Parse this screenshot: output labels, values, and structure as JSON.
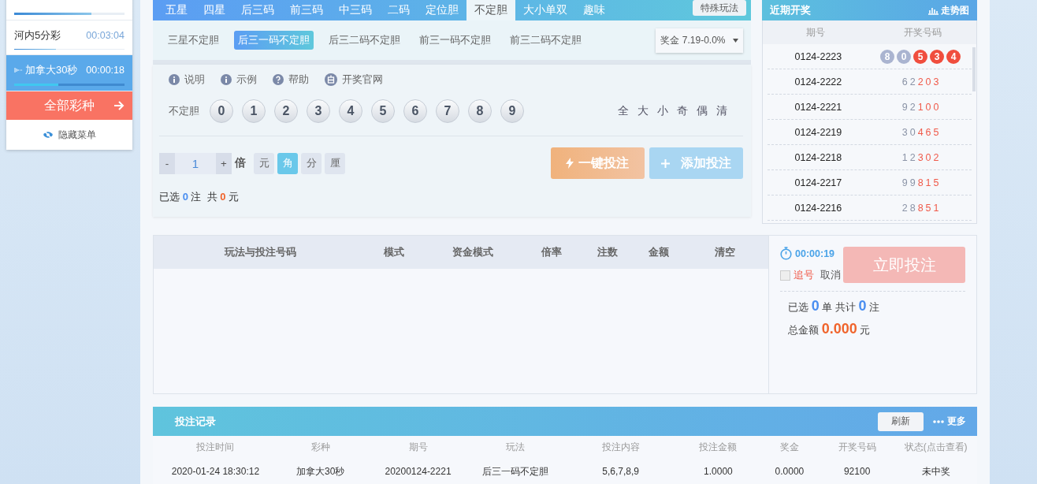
{
  "lotteries": [
    {
      "level": 0.7,
      "selected": false
    },
    {
      "name": "河内5分彩",
      "time": "00:03:04",
      "level": 0.38,
      "selected": false
    },
    {
      "name": "加拿大30秒",
      "time": "00:00:18",
      "level": 0.4,
      "selected": true
    }
  ],
  "all_button": "全部彩种",
  "hide_menu": "隐藏菜单",
  "tabs": [
    {
      "label": "五星",
      "selected": false
    },
    {
      "label": "四星",
      "selected": false
    },
    {
      "label": "后三码",
      "selected": false
    },
    {
      "label": "前三码",
      "selected": false
    },
    {
      "label": "中三码",
      "selected": false
    },
    {
      "label": "二码",
      "selected": false
    },
    {
      "label": "定位胆",
      "selected": false
    },
    {
      "label": "不定胆",
      "selected": true
    },
    {
      "label": "大小单双",
      "selected": false
    },
    {
      "label": "趣味",
      "selected": false
    }
  ],
  "special_button": "特殊玩法",
  "subtabs": [
    {
      "label": "三星不定胆",
      "selected": false
    },
    {
      "label": "后三一码不定胆",
      "selected": true
    },
    {
      "label": "后三二码不定胆",
      "selected": false
    },
    {
      "label": "前三一码不定胆",
      "selected": false
    },
    {
      "label": "前三二码不定胆",
      "selected": false
    }
  ],
  "prize_select": "奖金 7.19-0.0%",
  "info_links": [
    {
      "kind": "info",
      "label": "说明"
    },
    {
      "kind": "info",
      "label": "示例"
    },
    {
      "kind": "help",
      "label": "帮助"
    },
    {
      "kind": "official",
      "label": "开奖官网"
    }
  ],
  "pick_label": "不定胆",
  "balls": [
    "0",
    "1",
    "2",
    "3",
    "4",
    "5",
    "6",
    "7",
    "8",
    "9"
  ],
  "quick_picks": [
    "全",
    "大",
    "小",
    "奇",
    "偶",
    "清"
  ],
  "multiplier": {
    "minus": "-",
    "value": "1",
    "plus": "+",
    "unit": "倍"
  },
  "units": [
    {
      "label": "元",
      "selected": false
    },
    {
      "label": "角",
      "selected": true
    },
    {
      "label": "分",
      "selected": false
    },
    {
      "label": "厘",
      "selected": false
    }
  ],
  "one_click": "一键投注",
  "add_bet": "添加投注",
  "summary": {
    "selected_label": "已选",
    "count": "0",
    "count_unit": "注",
    "total_label": "共",
    "amount": "0",
    "amount_unit": "元"
  },
  "recent": {
    "title": "近期开奖",
    "trend": "走势图",
    "columns": [
      "期号",
      "开奖号码"
    ],
    "rows": [
      {
        "issue": "0124-2223",
        "latest": true,
        "digits": [
          {
            "d": "8",
            "hot": false
          },
          {
            "d": "0",
            "hot": false
          },
          {
            "d": "5",
            "hot": true
          },
          {
            "d": "3",
            "hot": true
          },
          {
            "d": "4",
            "hot": true
          }
        ]
      },
      {
        "issue": "0124-2222",
        "latest": false,
        "digits": [
          {
            "d": "6",
            "hot": false
          },
          {
            "d": "2",
            "hot": false
          },
          {
            "d": "2",
            "hot": true
          },
          {
            "d": "0",
            "hot": true
          },
          {
            "d": "3",
            "hot": true
          }
        ]
      },
      {
        "issue": "0124-2221",
        "latest": false,
        "digits": [
          {
            "d": "9",
            "hot": false
          },
          {
            "d": "2",
            "hot": false
          },
          {
            "d": "1",
            "hot": true
          },
          {
            "d": "0",
            "hot": true
          },
          {
            "d": "0",
            "hot": true
          }
        ]
      },
      {
        "issue": "0124-2219",
        "latest": false,
        "digits": [
          {
            "d": "3",
            "hot": false
          },
          {
            "d": "0",
            "hot": false
          },
          {
            "d": "4",
            "hot": true
          },
          {
            "d": "6",
            "hot": true
          },
          {
            "d": "5",
            "hot": true
          }
        ]
      },
      {
        "issue": "0124-2218",
        "latest": false,
        "digits": [
          {
            "d": "1",
            "hot": false
          },
          {
            "d": "2",
            "hot": false
          },
          {
            "d": "3",
            "hot": true
          },
          {
            "d": "0",
            "hot": true
          },
          {
            "d": "2",
            "hot": true
          }
        ]
      },
      {
        "issue": "0124-2217",
        "latest": false,
        "digits": [
          {
            "d": "9",
            "hot": false
          },
          {
            "d": "9",
            "hot": false
          },
          {
            "d": "8",
            "hot": true
          },
          {
            "d": "1",
            "hot": true
          },
          {
            "d": "5",
            "hot": true
          }
        ]
      },
      {
        "issue": "0124-2216",
        "latest": false,
        "digits": [
          {
            "d": "2",
            "hot": false
          },
          {
            "d": "8",
            "hot": false
          },
          {
            "d": "8",
            "hot": true
          },
          {
            "d": "5",
            "hot": true
          },
          {
            "d": "1",
            "hot": true
          }
        ]
      }
    ]
  },
  "cart_columns": [
    "玩法与投注号码",
    "模式",
    "资金模式",
    "倍率",
    "注数",
    "金额",
    "清空"
  ],
  "checkout": {
    "countdown": "00:00:19",
    "chase_label": "追号",
    "chase_checked": false,
    "cancel": "取消",
    "submit": "立即投注",
    "selected_label": "已选",
    "orders": "0",
    "orders_unit": "单",
    "total_label": "共计",
    "bets": "0",
    "bets_unit": "注",
    "amount_label": "总金额",
    "amount": "0.000",
    "amount_unit": "元"
  },
  "records": {
    "title": "投注记录",
    "refresh": "刷新",
    "more": "更多",
    "columns": [
      "投注时间",
      "彩种",
      "期号",
      "玩法",
      "投注内容",
      "投注金额",
      "奖金",
      "开奖号码",
      "状态(点击查看)"
    ],
    "rows": [
      [
        "2020-01-24 18:30:12",
        "加拿大30秒",
        "20200124-2221",
        "后三一码不定胆",
        "5,6,7,8,9",
        "1.0000",
        "0.0000",
        "92100",
        "未中奖"
      ]
    ]
  }
}
